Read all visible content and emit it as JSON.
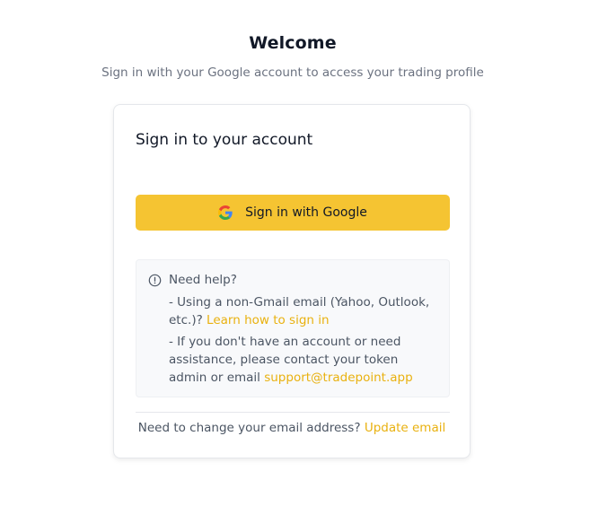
{
  "header": {
    "title": "Welcome",
    "subtitle": "Sign in with your Google account to access your trading profile"
  },
  "card": {
    "title": "Sign in to your account",
    "google_button_label": "Sign in with Google",
    "help": {
      "heading": "Need help?",
      "item1_prefix": "- Using a non-Gmail email (Yahoo, Outlook, etc.)? ",
      "item1_link": "Learn how to sign in",
      "item2_prefix": "- If you don't have an account or need assistance, please contact your token admin or email ",
      "item2_link": "support@tradepoint.app"
    },
    "footer": {
      "prefix": "Need to change your email address? ",
      "link": "Update email"
    }
  },
  "colors": {
    "accent": "#f5c432",
    "link": "#e9b10f",
    "help_background": "#f8f9fb"
  },
  "icons": {
    "google": "google-icon",
    "help": "info-circle-icon"
  }
}
